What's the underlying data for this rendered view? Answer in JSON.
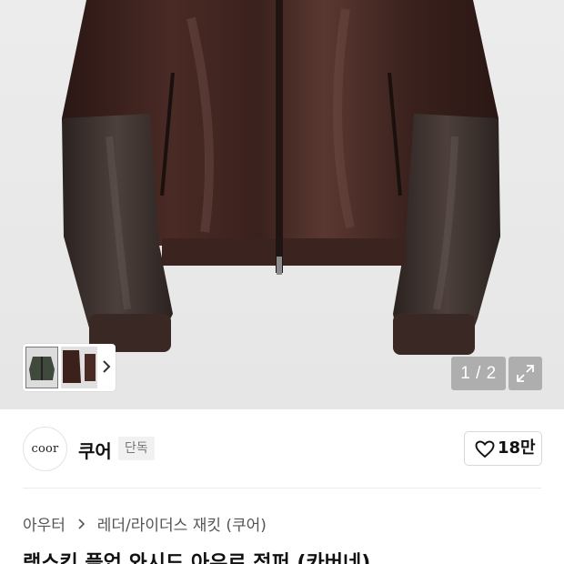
{
  "gallery": {
    "current_page": "1",
    "total_pages": "2",
    "page_separator": "/"
  },
  "brand": {
    "logo_text": "coor",
    "name": "쿠어",
    "badge": "단독"
  },
  "like": {
    "count": "18만"
  },
  "breadcrumb": {
    "items": [
      "아우터",
      "레더/라이더스 재킷 (쿠어)"
    ]
  },
  "product": {
    "title": "램스킨 플업 와시드 아우르 점퍼 (카버네)"
  },
  "colors": {
    "leather": "#3b201b",
    "leather_highlight": "#6b4a42",
    "background": "#e8e8e8"
  }
}
